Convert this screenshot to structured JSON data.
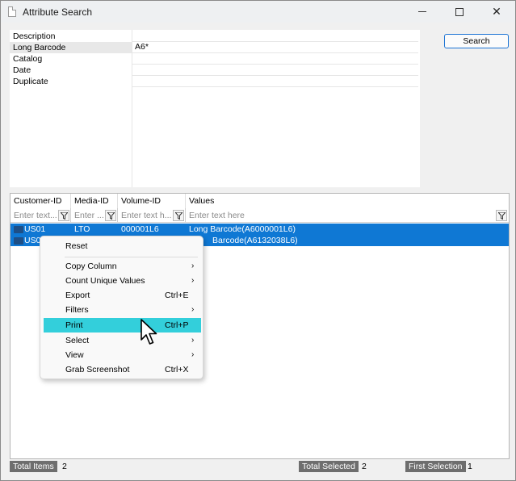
{
  "window": {
    "title": "Attribute Search",
    "minimize_glyph": "",
    "maximize_glyph": "",
    "close_glyph": "✕"
  },
  "criteria": [
    {
      "label": "Description",
      "value": ""
    },
    {
      "label": "Long Barcode",
      "value": "A6*"
    },
    {
      "label": "Catalog",
      "value": ""
    },
    {
      "label": "Date",
      "value": ""
    },
    {
      "label": "Duplicate",
      "value": ""
    }
  ],
  "search_button": "Search",
  "grid": {
    "columns": [
      "Customer-ID",
      "Media-ID",
      "Volume-ID",
      "Values"
    ],
    "filter_placeholders": [
      "Enter text...",
      "Enter ...",
      "Enter text h...",
      "Enter text here"
    ],
    "rows": [
      {
        "customer_id": "US01",
        "media_id": "LTO",
        "volume_id": "000001L6",
        "values": "Long Barcode(A6000001L6)"
      },
      {
        "customer_id": "US0",
        "media_id": "",
        "volume_id": "",
        "values": "Barcode(A6132038L6)"
      }
    ],
    "selection_color": "#0f78d4"
  },
  "context_menu": {
    "highlight_color": "#33cfdb",
    "items": [
      {
        "label": "Reset",
        "shortcut": "",
        "submenu": false
      },
      {
        "label": "Copy Column",
        "shortcut": "",
        "submenu": true
      },
      {
        "label": "Count Unique Values",
        "shortcut": "",
        "submenu": true
      },
      {
        "label": "Export",
        "shortcut": "Ctrl+E",
        "submenu": false
      },
      {
        "label": "Filters",
        "shortcut": "",
        "submenu": true
      },
      {
        "label": "Print",
        "shortcut": "Ctrl+P",
        "submenu": false,
        "hovered": true
      },
      {
        "label": "Select",
        "shortcut": "",
        "submenu": true
      },
      {
        "label": "View",
        "shortcut": "",
        "submenu": true
      },
      {
        "label": "Grab Screenshot",
        "shortcut": "Ctrl+X",
        "submenu": false
      }
    ],
    "arrow_glyph": "›"
  },
  "status": {
    "total_items_label": "Total Items",
    "total_items_value": "2",
    "total_selected_label": "Total Selected",
    "total_selected_value": "2",
    "first_selection_label": "First Selection",
    "first_selection_value": "1"
  }
}
